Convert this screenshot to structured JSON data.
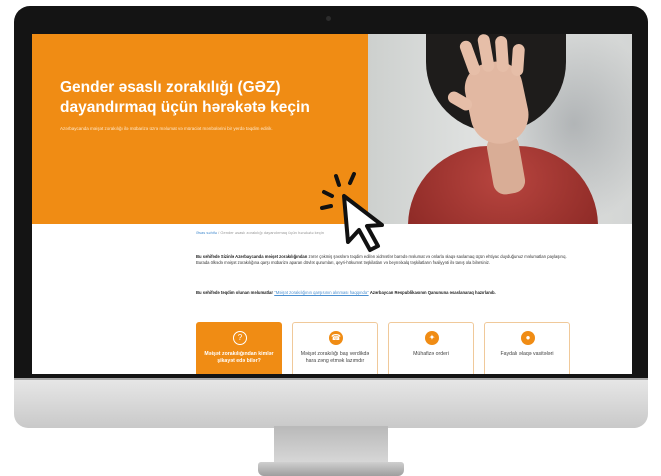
{
  "hero": {
    "title": "Gender əsaslı zorakılığı (GƏZ) dayandırmaq üçün hərəkətə keçin",
    "subtitle": "Azərbaycanda məişət zorakılığı ilə mübarizə üzrə məlumat və müraciət mənbələrini bir yerdə təqdim edirik."
  },
  "breadcrumb": {
    "home": "Əsas səhifə",
    "separator": "/",
    "current": "Gender əsaslı zorakılığı dayandırmaq üçün hərəkətə keçin"
  },
  "intro": {
    "lead_bold": "Bu səhifədə Sizinlə Azərbaycanda məişət zorakılığından",
    "lead_rest": "zərər çəkmiş şəxslərə təqdim edilən xidmətlər barədə məlumat və onlarla əlaqə saxlamaq üçün ehtiyac duyduğunuz məlumatları paylaşırıq. Burada ölkədə məişət zorakılığına qarşı mübarizə aparan dövlət qurumları, qeyri-hökumət təşkilatları və beynəlxalq təşkilatların fəaliyyəti ilə tanış ola bilərsiniz."
  },
  "note": {
    "bold": "Bu səhifədə təqdim olunan məlumatlar",
    "link": "\"Məişət zorakılığının qarşısının alınması haqqında\"",
    "rest": "Azərbaycan Respublikasının Qanununa əsaslanaraq hazırlanıb."
  },
  "cards": [
    {
      "label": "Məişət zorakılığından kimlər şikayət edə bilər?",
      "icon": "question-icon",
      "active": true
    },
    {
      "label": "Məişət zorakılığı baş verdikdə hara zəng etmək lazımdır",
      "icon": "phone-icon",
      "active": false
    },
    {
      "label": "Mühafizə orderi",
      "icon": "shield-icon",
      "active": false
    },
    {
      "label": "Faydalı əlaqə vasitələri",
      "icon": "chat-icon",
      "active": false
    }
  ],
  "colors": {
    "accent": "#f08c14",
    "link": "#4a8fd0"
  }
}
